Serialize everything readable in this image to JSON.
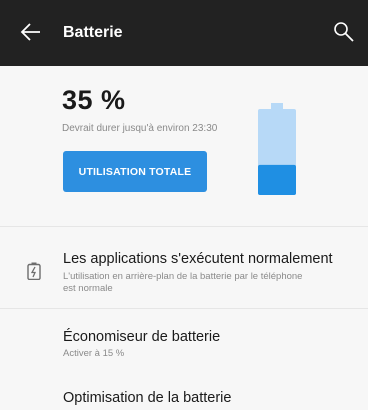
{
  "appbar": {
    "title": "Batterie",
    "back_icon": "arrow-left-icon",
    "search_icon": "search-icon"
  },
  "summary": {
    "percent_text": "35 %",
    "estimate_text": "Devrait durer jusqu'à environ 23:30",
    "battery_level": 0.35,
    "button_label": "UTILISATION TOTALE"
  },
  "status_row": {
    "icon": "battery-charging-icon",
    "title": "Les applications s'exécutent normalement",
    "subtitle_line1": "L'utilisation en arrière-plan de la batterie par le téléphone",
    "subtitle_line2": "est normale"
  },
  "saver_row": {
    "title": "Économiseur de batterie",
    "subtitle": "Activer à 15 %"
  },
  "optimization_row": {
    "title": "Optimisation de la batterie"
  },
  "colors": {
    "appbar_bg": "#222222",
    "accent": "#2d8fe0",
    "battery_fill": "#1f8fe3",
    "battery_empty": "#b7d9f7"
  }
}
